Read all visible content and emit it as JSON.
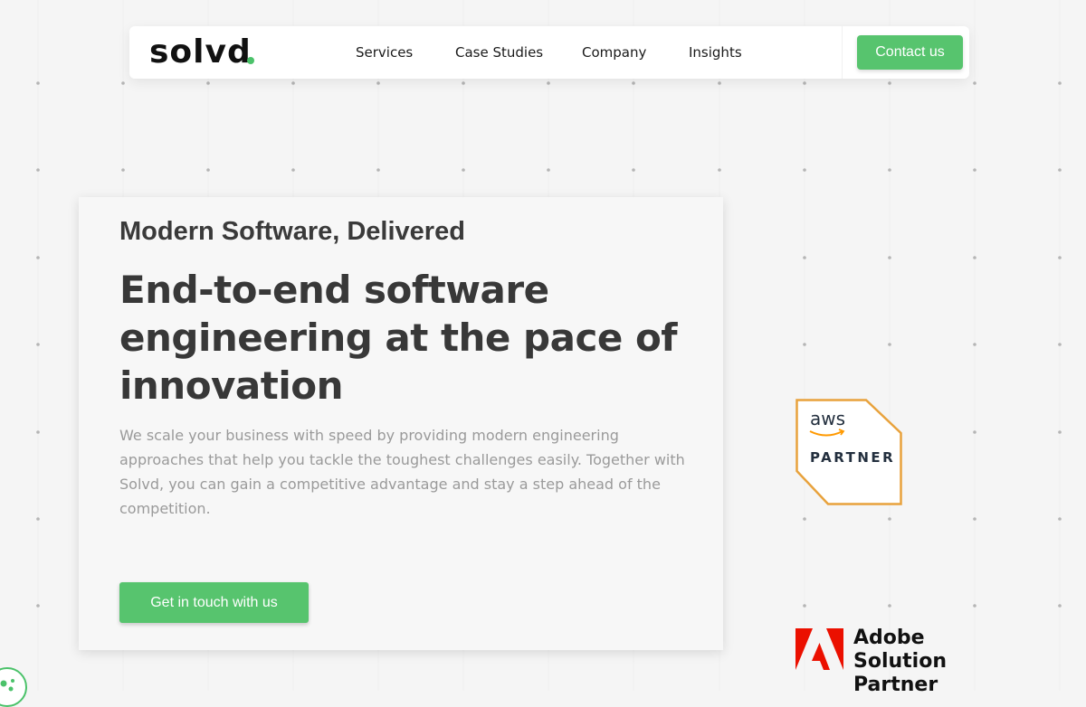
{
  "colors": {
    "brand_green": "#57c46e",
    "text_dark": "#383838",
    "text_muted": "#9a9a9a",
    "aws_orange": "#e8a23c",
    "adobe_red": "#eb1000"
  },
  "header": {
    "logo_text": "solvd",
    "nav_items": [
      {
        "label": "Services"
      },
      {
        "label": "Case Studies"
      },
      {
        "label": "Company"
      },
      {
        "label": "Insights"
      }
    ],
    "contact_label": "Contact us"
  },
  "hero": {
    "eyebrow": "Modern Software, Delivered",
    "headline": "End-to-end software engineering at the pace of innovation",
    "description": "We scale your business with speed by providing modern engineering approaches that help you tackle the toughest challenges easily. Together with Solvd, you can gain a competitive advantage and stay a step ahead of the competition.",
    "cta_label": "Get in touch with us"
  },
  "badges": {
    "aws": {
      "logo_text": "aws",
      "label": "PARTNER"
    },
    "adobe": {
      "line1": "Adobe",
      "line2": "Solution Partner"
    }
  },
  "cookie": {
    "icon": "cookie-icon"
  }
}
